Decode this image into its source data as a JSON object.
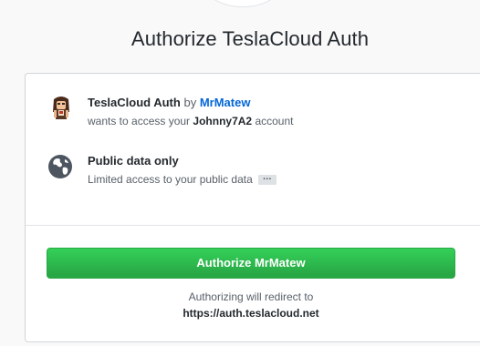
{
  "page": {
    "title": "Authorize TeslaCloud Auth"
  },
  "app": {
    "name": "TeslaCloud Auth",
    "by_text": "by",
    "developer": "MrMatew",
    "request_prefix": "wants to access your",
    "account": "Johnny7A2",
    "request_suffix": "account",
    "avatar_icon": "developer-avatar"
  },
  "scope": {
    "icon": "globe-icon",
    "title": "Public data only",
    "description": "Limited access to your public data",
    "more_label": "…"
  },
  "actions": {
    "authorize_label": "Authorize MrMatew",
    "redirect_prefix": "Authorizing will redirect to",
    "redirect_url": "https://auth.teslacloud.net"
  },
  "colors": {
    "primary_green": "#28a745",
    "link_blue": "#0366d6",
    "text_dark": "#24292e",
    "text_muted": "#586069"
  }
}
